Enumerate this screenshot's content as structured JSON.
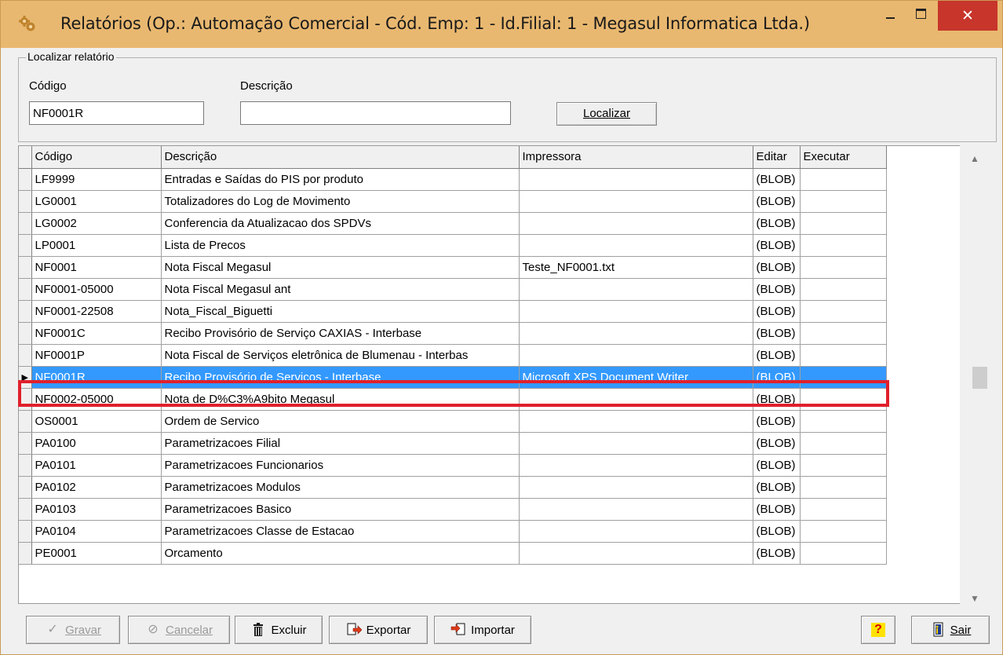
{
  "window": {
    "title": "Relatórios (Op.: Automação Comercial - Cód. Emp: 1 - Id.Filial: 1 - Megasul Informatica Ltda.)",
    "close_glyph": "✕"
  },
  "search": {
    "legend": "Localizar relatório",
    "code_label": "Código",
    "code_value": "NF0001R",
    "desc_label": "Descrição",
    "desc_value": "",
    "find_button": "Localizar"
  },
  "grid": {
    "columns": [
      "Código",
      "Descrição",
      "Impressora",
      "Editar",
      "Executar"
    ],
    "rows": [
      {
        "code": "LF9999",
        "desc": "Entradas e Saídas do PIS por produto",
        "printer": "",
        "edit": "(BLOB)",
        "exec": ""
      },
      {
        "code": "LG0001",
        "desc": "Totalizadores do Log de Movimento",
        "printer": "",
        "edit": "(BLOB)",
        "exec": ""
      },
      {
        "code": "LG0002",
        "desc": "Conferencia da Atualizacao dos SPDVs",
        "printer": "",
        "edit": "(BLOB)",
        "exec": ""
      },
      {
        "code": "LP0001",
        "desc": "Lista de Precos",
        "printer": "",
        "edit": "(BLOB)",
        "exec": ""
      },
      {
        "code": "NF0001",
        "desc": "Nota Fiscal Megasul",
        "printer": "Teste_NF0001.txt",
        "edit": "(BLOB)",
        "exec": ""
      },
      {
        "code": "NF0001-05000",
        "desc": "Nota Fiscal Megasul ant",
        "printer": "",
        "edit": "(BLOB)",
        "exec": ""
      },
      {
        "code": "NF0001-22508",
        "desc": "Nota_Fiscal_Biguetti",
        "printer": "",
        "edit": "(BLOB)",
        "exec": ""
      },
      {
        "code": "NF0001C",
        "desc": "Recibo Provisório de Serviço CAXIAS - Interbase",
        "printer": "",
        "edit": "(BLOB)",
        "exec": ""
      },
      {
        "code": "NF0001P",
        "desc": "Nota Fiscal de Serviços eletrônica de Blumenau - Interbas",
        "printer": "",
        "edit": "(BLOB)",
        "exec": ""
      },
      {
        "code": "NF0001R",
        "desc": "Recibo Provisório de Serviços - Interbase",
        "printer": "Microsoft XPS Document Writer",
        "edit": "(BLOB)",
        "exec": ""
      },
      {
        "code": "NF0002-05000",
        "desc": "Nota de D%C3%A9bito Megasul",
        "printer": "",
        "edit": "(BLOB)",
        "exec": ""
      },
      {
        "code": "OS0001",
        "desc": "Ordem de Servico",
        "printer": "",
        "edit": "(BLOB)",
        "exec": ""
      },
      {
        "code": "PA0100",
        "desc": "Parametrizacoes Filial",
        "printer": "",
        "edit": "(BLOB)",
        "exec": ""
      },
      {
        "code": "PA0101",
        "desc": "Parametrizacoes Funcionarios",
        "printer": "",
        "edit": "(BLOB)",
        "exec": ""
      },
      {
        "code": "PA0102",
        "desc": "Parametrizacoes Modulos",
        "printer": "",
        "edit": "(BLOB)",
        "exec": ""
      },
      {
        "code": "PA0103",
        "desc": "Parametrizacoes Basico",
        "printer": "",
        "edit": "(BLOB)",
        "exec": ""
      },
      {
        "code": "PA0104",
        "desc": "Parametrizacoes Classe de Estacao",
        "printer": "",
        "edit": "(BLOB)",
        "exec": ""
      },
      {
        "code": "PE0001",
        "desc": "Orcamento",
        "printer": "",
        "edit": "(BLOB)",
        "exec": ""
      }
    ],
    "selected_code": "NF0001R",
    "row_indicator": "▶"
  },
  "toolbar": {
    "save": "Gravar",
    "cancel": "Cancelar",
    "delete": "Excluir",
    "export": "Exportar",
    "import": "Importar",
    "help": "?",
    "exit": "Sair"
  },
  "colors": {
    "title_bar": "#e9b870",
    "close_button": "#c7352b",
    "selection": "#3399ff",
    "highlight_frame": "#e0202c"
  }
}
